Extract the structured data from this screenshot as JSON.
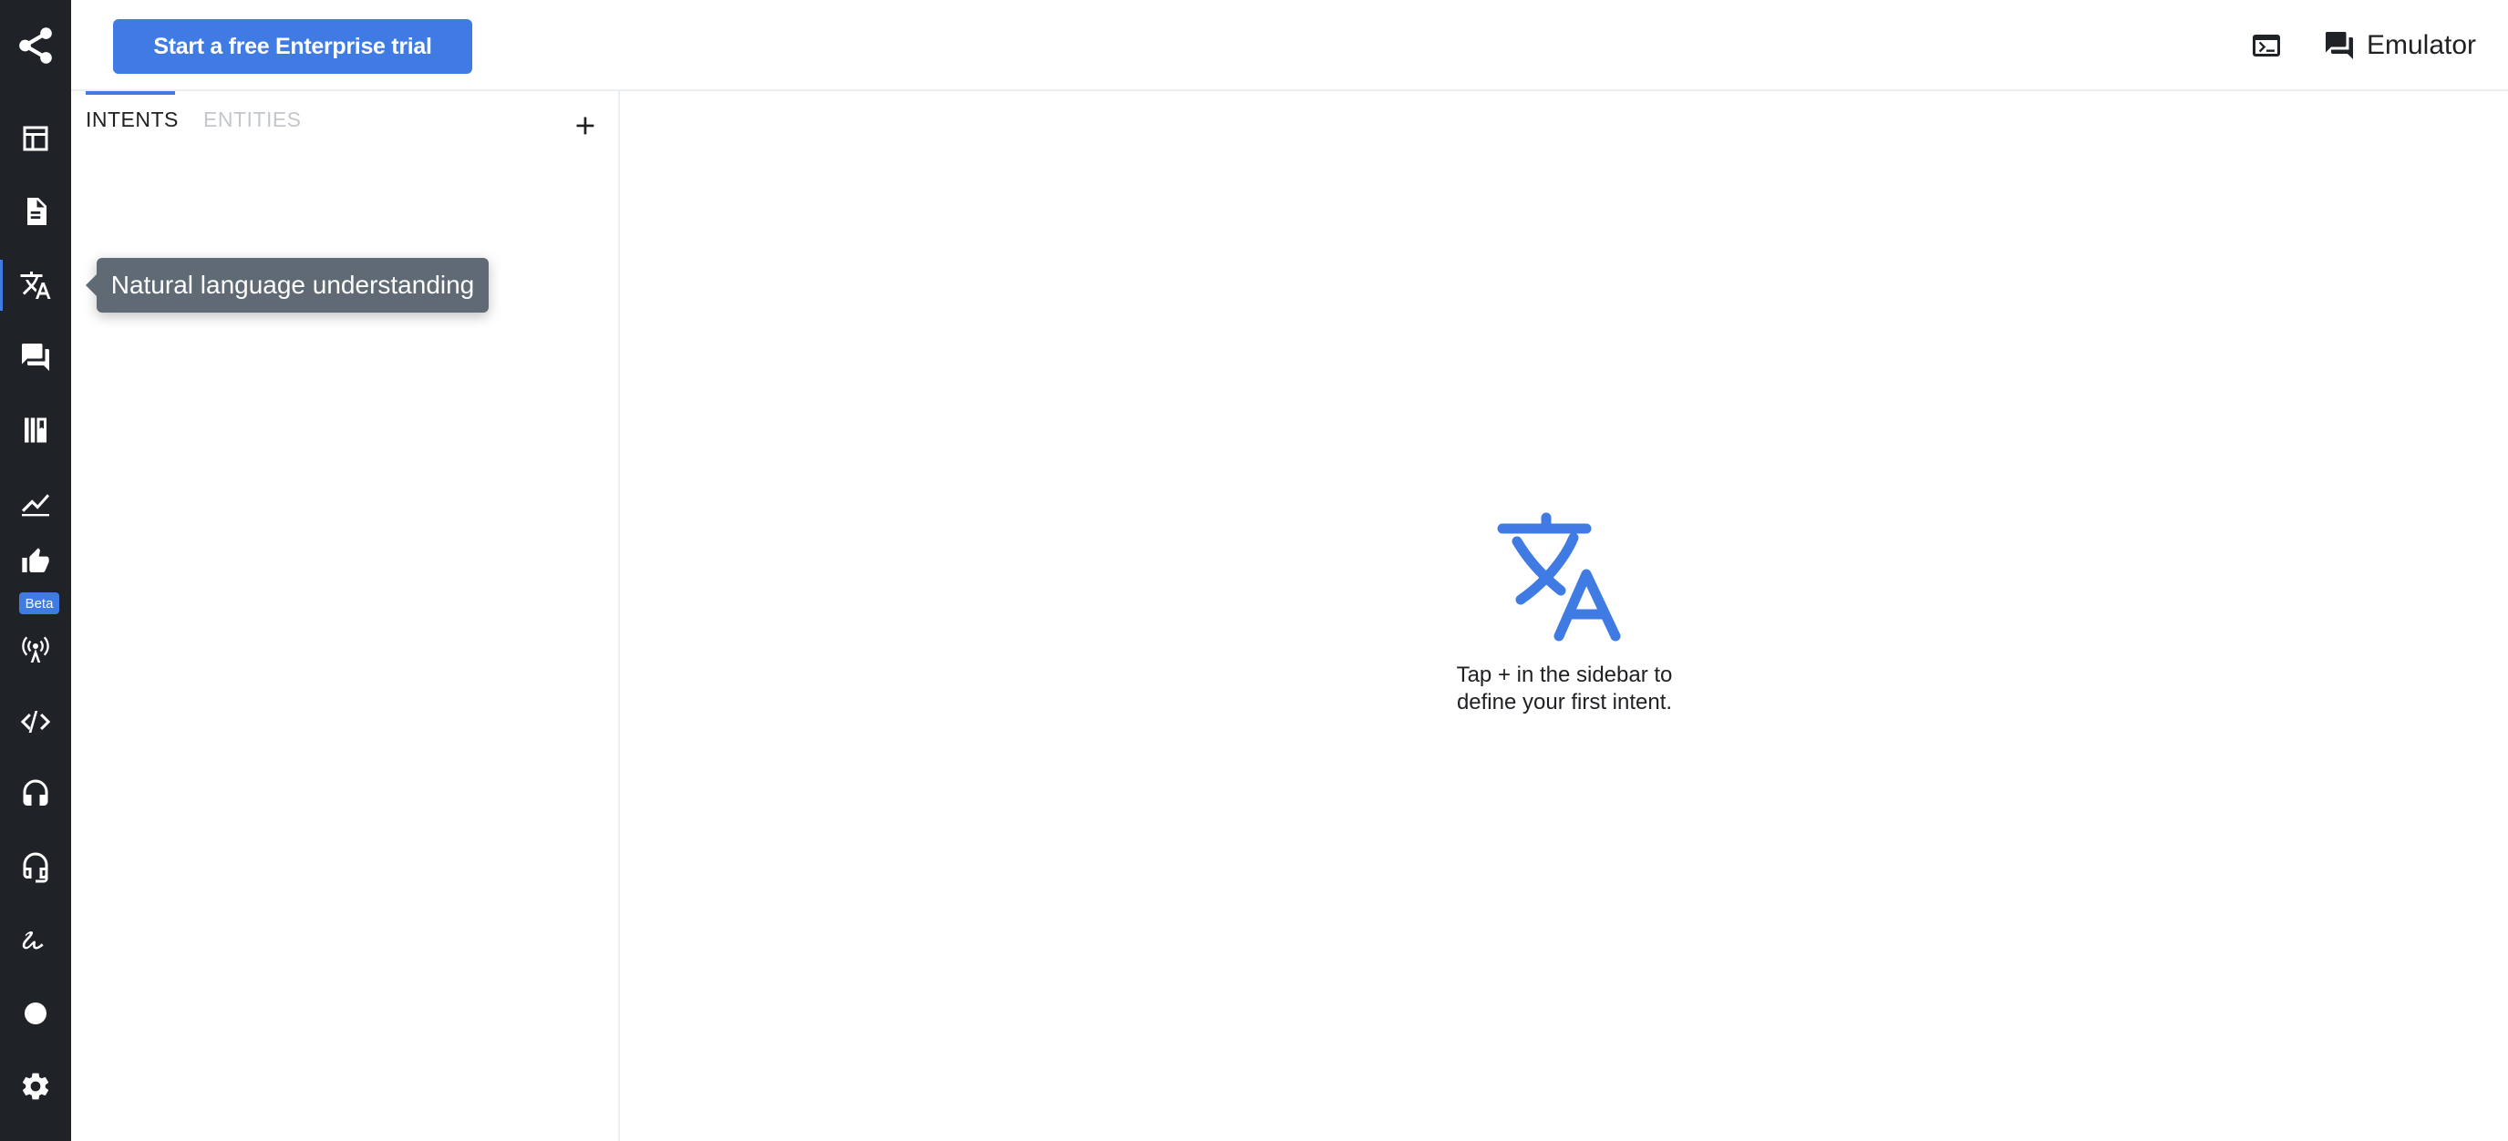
{
  "topbar": {
    "trial_button": "Start a free Enterprise trial",
    "terminal_icon": "terminal-icon",
    "emulator_label": "Emulator"
  },
  "rail": {
    "logo_icon": "share-nodes-icon",
    "items": [
      {
        "icon": "dashboard-icon",
        "active": false
      },
      {
        "icon": "document-icon",
        "active": false
      },
      {
        "icon": "translate-icon",
        "active": true
      },
      {
        "icon": "chat-bubbles-icon",
        "active": false
      },
      {
        "icon": "library-books-icon",
        "active": false
      },
      {
        "icon": "line-chart-icon",
        "active": false
      },
      {
        "icon": "thumb-up-icon",
        "active": false,
        "badge": "Beta"
      },
      {
        "icon": "broadcast-antenna-icon",
        "active": false
      },
      {
        "icon": "code-icon",
        "active": false
      },
      {
        "icon": "headset-icon",
        "active": false
      },
      {
        "icon": "headset-outline-icon",
        "active": false
      },
      {
        "icon": "signature-icon",
        "active": false
      },
      {
        "icon": "dot-icon",
        "active": false
      },
      {
        "icon": "gear-icon",
        "active": false
      }
    ]
  },
  "panel": {
    "tabs": [
      {
        "label": "INTENTS",
        "active": true
      },
      {
        "label": "ENTITIES",
        "active": false
      }
    ],
    "add_icon": "plus-icon"
  },
  "tooltip": {
    "text": "Natural language understanding"
  },
  "empty_state": {
    "icon": "translate-icon",
    "line1": "Tap + in the sidebar to",
    "line2": "define your first intent."
  },
  "colors": {
    "accent": "#3f7be3",
    "rail_background": "#1f2328",
    "tooltip_background": "#5f6a74",
    "tab_inactive": "#c3c7cc"
  }
}
